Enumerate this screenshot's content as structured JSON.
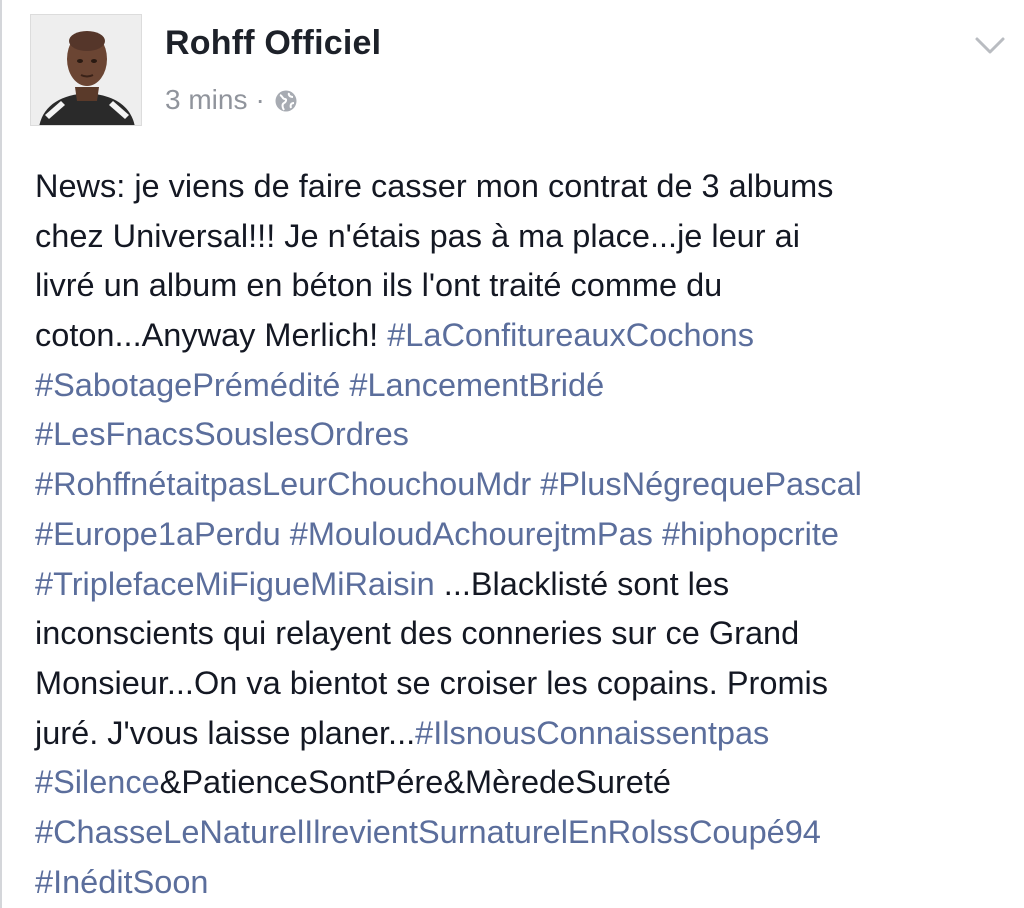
{
  "author": {
    "name": "Rohff Officiel"
  },
  "meta": {
    "time": "3 mins",
    "separator": "·"
  },
  "icons": {
    "privacy": "globe-icon",
    "menu": "chevron-down-icon",
    "hashtag_color": "#5b6e9c",
    "text_color": "#141823"
  },
  "post": {
    "lines": [
      [
        {
          "t": "News: je viens de faire casser mon contrat de 3 albums",
          "h": false
        }
      ],
      [
        {
          "t": "chez Universal!!! Je n'étais pas à ma place...je leur ai",
          "h": false
        }
      ],
      [
        {
          "t": "livré un album en béton ils l'ont traité comme du",
          "h": false
        }
      ],
      [
        {
          "t": "coton...Anyway Merlich! ",
          "h": false
        },
        {
          "t": "#LaConfitureauxCochons",
          "h": true
        }
      ],
      [
        {
          "t": "#SabotagePrémédité",
          "h": true
        },
        {
          "t": " ",
          "h": false
        },
        {
          "t": "#LancementBridé",
          "h": true
        }
      ],
      [
        {
          "t": "#LesFnacsSouslesOrdres",
          "h": true
        }
      ],
      [
        {
          "t": "#RohffnétaitpasLeurChouchouMdr",
          "h": true
        },
        {
          "t": " ",
          "h": false
        },
        {
          "t": "#PlusNégrequePascal",
          "h": true
        }
      ],
      [
        {
          "t": "#Europe1aPerdu",
          "h": true
        },
        {
          "t": " ",
          "h": false
        },
        {
          "t": "#MouloudAchourejtmPas",
          "h": true
        },
        {
          "t": " ",
          "h": false
        },
        {
          "t": "#hiphopcrite",
          "h": true
        }
      ],
      [
        {
          "t": "#TriplefaceMiFigueMiRaisin",
          "h": true
        },
        {
          "t": " ...Blacklisté sont les",
          "h": false
        }
      ],
      [
        {
          "t": "inconscients qui relayent des conneries sur ce Grand",
          "h": false
        }
      ],
      [
        {
          "t": "Monsieur...On va bientot se croiser les copains. Promis",
          "h": false
        }
      ],
      [
        {
          "t": "juré. J'vous laisse planer...",
          "h": false
        },
        {
          "t": "#IlsnousConnaissentpas",
          "h": true
        }
      ],
      [
        {
          "t": "#Silence",
          "h": true
        },
        {
          "t": "&PatienceSontPére&MèredeSureté",
          "h": false
        }
      ],
      [
        {
          "t": "#ChasseLeNaturelIlrevientSurnaturelEnRolssCoupé94",
          "h": true
        }
      ],
      [
        {
          "t": "#InéditSoon",
          "h": true
        }
      ]
    ]
  }
}
